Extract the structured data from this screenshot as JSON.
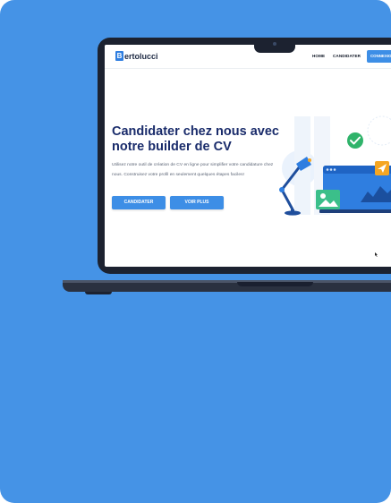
{
  "navbar": {
    "logo_letter": "B",
    "logo_rest": "ertolucci",
    "links": [
      "HOME",
      "CANDIDATER"
    ],
    "cta_label": "CONNEXION"
  },
  "hero": {
    "title": "Candidater chez nous avec notre builder de CV",
    "description": "Utilisez notre outil de création de CV en ligne pour simplifier votre candidature chez nous. Construisez votre profil en seulement quelques étapes faciles!",
    "primary_button": "CANDIDATER",
    "secondary_button": "VOIR PLUS"
  },
  "colors": {
    "background": "#4593e6",
    "accent": "#3d8ee6",
    "title": "#1a2c6b",
    "laptop_frame": "#1c2230"
  },
  "icons": [
    "desk-lamp-icon",
    "checkmark-badge-icon",
    "image-icon",
    "paper-plane-icon",
    "line-graph-icon",
    "mouse-cursor-icon"
  ]
}
